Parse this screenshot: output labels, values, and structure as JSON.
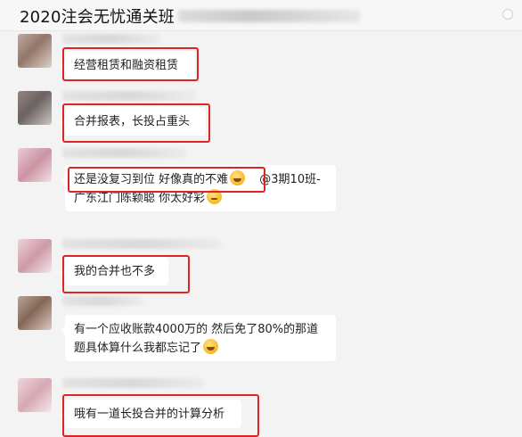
{
  "window": {
    "title": "2020注会无忧通关班"
  },
  "colors": {
    "highlight": "#e02424",
    "bubble": "#ffffff",
    "background": "#f3f3f3"
  },
  "messages": [
    {
      "text": "经营租赁和融资租赁"
    },
    {
      "text": "合并报表，长投占重头"
    },
    {
      "line1_a": "还是没复习到位 好像真的不难",
      "line1_b": "@3期10班-",
      "line2": "广东江门陈颖聪 你太好彩"
    },
    {
      "text": "我的合并也不多"
    },
    {
      "line1": "有一个应收账款4000万的 然后免了80%的那道",
      "line2": "题具体算什么我都忘记了"
    },
    {
      "text": "哦有一道长投合并的计算分析"
    }
  ]
}
